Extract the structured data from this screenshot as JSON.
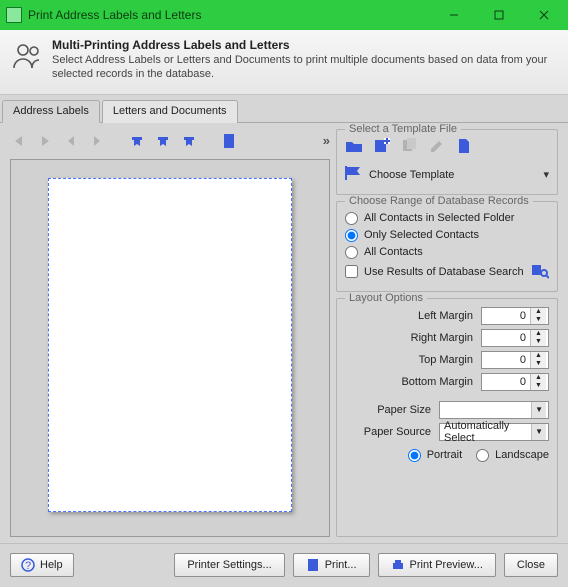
{
  "window": {
    "title": "Print Address Labels and Letters"
  },
  "header": {
    "title": "Multi-Printing Address Labels and Letters",
    "desc": "Select Address Labels or Letters and Documents to print multiple documents based on data from your selected records in the database."
  },
  "tabs": {
    "t1": "Address Labels",
    "t2": "Letters and Documents"
  },
  "template": {
    "legend": "Select a Template File",
    "choose_label": "Choose Template"
  },
  "range": {
    "legend": "Choose Range of Database Records",
    "opt_folder": "All Contacts in Selected Folder",
    "opt_selected": "Only Selected Contacts",
    "opt_all": "All Contacts",
    "opt_search": "Use Results of Database Search"
  },
  "layout": {
    "legend": "Layout Options",
    "left_margin_label": "Left Margin",
    "left_margin": "0",
    "right_margin_label": "Right Margin",
    "right_margin": "0",
    "top_margin_label": "Top Margin",
    "top_margin": "0",
    "bottom_margin_label": "Bottom Margin",
    "bottom_margin": "0",
    "paper_size_label": "Paper Size",
    "paper_size": "",
    "paper_source_label": "Paper Source",
    "paper_source": "Automatically Select",
    "portrait": "Portrait",
    "landscape": "Landscape"
  },
  "footer": {
    "help": "Help",
    "printer_settings": "Printer Settings...",
    "print": "Print...",
    "preview": "Print Preview...",
    "close": "Close"
  }
}
